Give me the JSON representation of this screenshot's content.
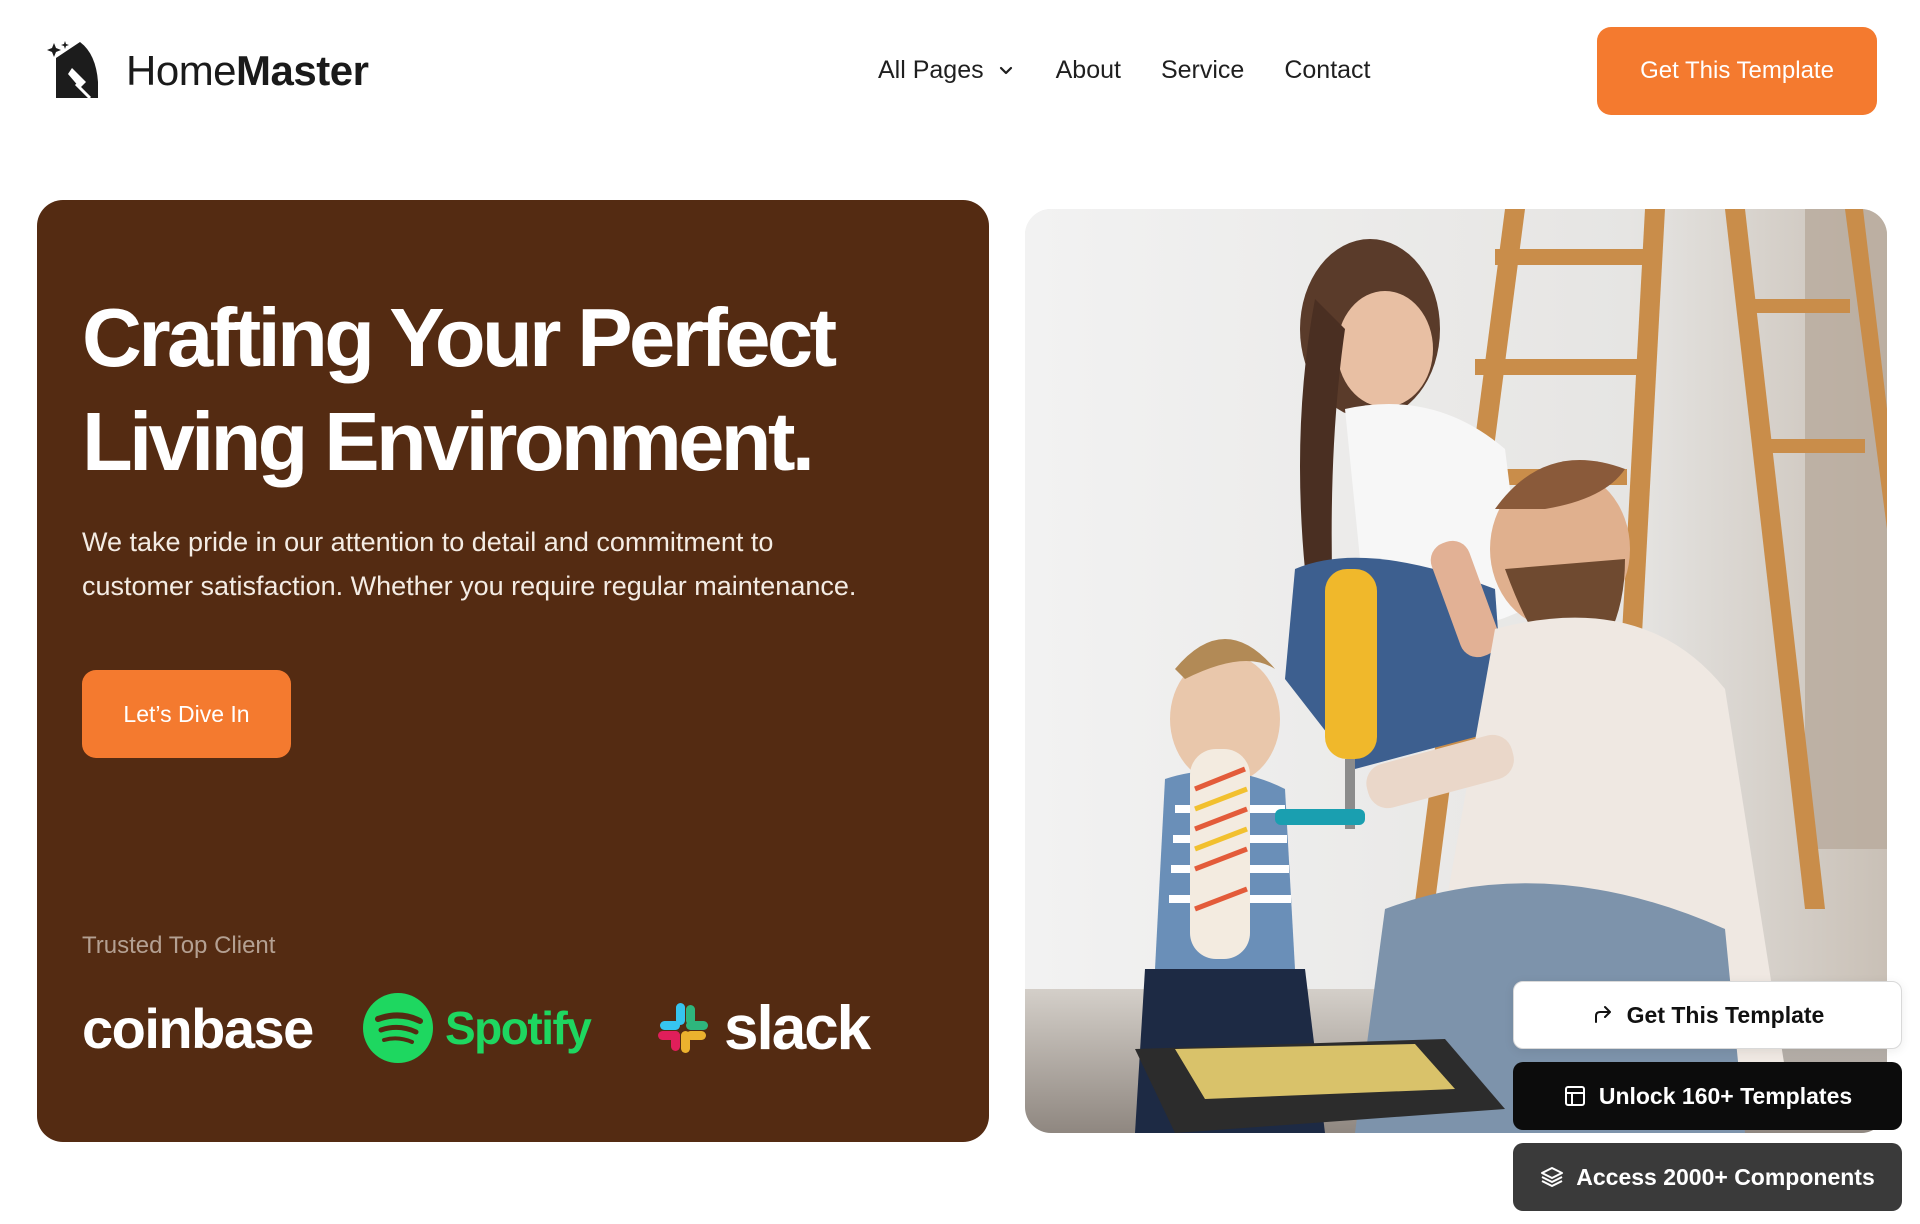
{
  "brand": {
    "name_regular": "Home",
    "name_bold": "Master",
    "icon": "homemaster-logo"
  },
  "nav": {
    "items": [
      {
        "label": "All Pages",
        "has_dropdown": true,
        "icon": "chevron-down-icon"
      },
      {
        "label": "About"
      },
      {
        "label": "Service"
      },
      {
        "label": "Contact"
      }
    ]
  },
  "header": {
    "cta_label": "Get This Template"
  },
  "hero": {
    "title_line1": "Crafting Your Perfect",
    "title_line2": "Living Environment.",
    "subtitle_line1": "We take pride in our attention to detail and commitment to",
    "subtitle_line2": "customer satisfaction. Whether you require regular maintenance.",
    "button_label": "Let’s Dive In",
    "trusted_label": "Trusted Top Client",
    "clients": [
      {
        "name": "coinbase",
        "icon": "coinbase-logo"
      },
      {
        "name": "Spotify",
        "icon": "spotify-logo"
      },
      {
        "name": "slack",
        "icon": "slack-logo"
      }
    ]
  },
  "photo": {
    "subject": "family-painting-home-photo"
  },
  "floating": {
    "buttons": [
      {
        "label": "Get This Template",
        "icon": "share-arrow-icon"
      },
      {
        "label": "Unlock 160+ Templates",
        "icon": "layout-icon"
      },
      {
        "label": "Access 2000+ Components",
        "icon": "layers-icon"
      }
    ]
  },
  "colors": {
    "accent": "#f47a2f",
    "hero_bg": "#542b12",
    "spotify_green": "#1ed760",
    "dark_button": "#0c0c0c",
    "gray_button": "#3a3a3a"
  }
}
